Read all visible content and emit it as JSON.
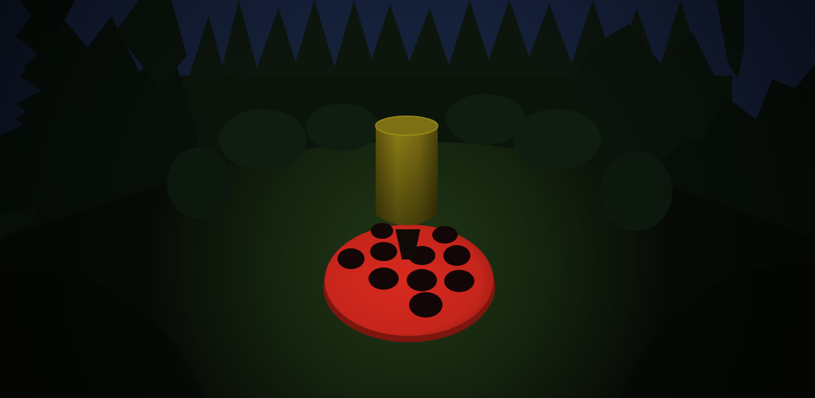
{
  "scene": {
    "type": "3d-game-viewport",
    "time_of_day": "night",
    "environment": "pine-forest-clearing",
    "colors": {
      "sky": "#17203a",
      "tree_dark": "#0a130b",
      "tree_mid": "#0f1d10",
      "ground_far": "#0e1a0d",
      "ground_lit": "#1a2c15",
      "cylinder": "#8a7a14",
      "cylinder_top": "#7a6c12",
      "base_red": "#d4281e",
      "base_rim": "#8a1a12",
      "hole": "#0d0505"
    },
    "objects": [
      {
        "name": "cylinder-tower",
        "shape": "cylinder",
        "color": "yellow-olive"
      },
      {
        "name": "red-base-plate",
        "shape": "disc",
        "color": "red",
        "hole_count": 10
      }
    ]
  }
}
